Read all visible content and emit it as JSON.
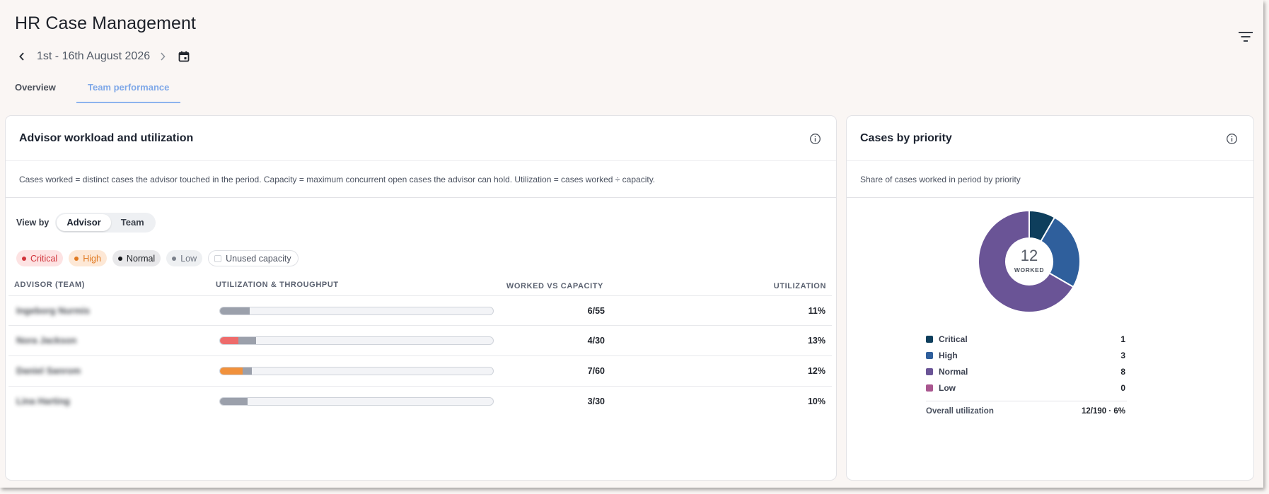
{
  "header": {
    "title": "HR Case Management",
    "date_range": "1st - 16th August 2026"
  },
  "tabs": [
    {
      "label": "Overview",
      "active": false
    },
    {
      "label": "Team performance",
      "active": true
    }
  ],
  "workload_card": {
    "title": "Advisor workload and utilization",
    "description": "Cases worked = distinct cases the advisor touched in the period. Capacity = maximum concurrent open cases the advisor can hold. Utilization = cases worked ÷ capacity.",
    "view_by": {
      "label": "View by",
      "options": [
        "Advisor",
        "Team"
      ],
      "selected": "Advisor"
    },
    "legend_chips": [
      "Critical",
      "High",
      "Normal",
      "Low",
      "Unused capacity"
    ],
    "columns": [
      "ADVISOR (TEAM)",
      "UTILIZATION & THROUGHPUT",
      "WORKED VS CAPACITY",
      "UTILIZATION"
    ],
    "rows": [
      {
        "advisor": "Ingeborg Nurmis",
        "worked": 6,
        "capacity": 55,
        "critical": 0,
        "high": 0,
        "normal": 6,
        "low": 0,
        "worked_vs_capacity": "6/55",
        "utilization": "11%"
      },
      {
        "advisor": "Nora Jackson",
        "worked": 4,
        "capacity": 30,
        "critical": 2,
        "high": 0,
        "normal": 2,
        "low": 0,
        "worked_vs_capacity": "4/30",
        "utilization": "13%"
      },
      {
        "advisor": "Daniel Sanrom",
        "worked": 7,
        "capacity": 60,
        "critical": 0,
        "high": 5,
        "normal": 2,
        "low": 0,
        "worked_vs_capacity": "7/60",
        "utilization": "12%"
      },
      {
        "advisor": "Lina Harting",
        "worked": 3,
        "capacity": 30,
        "critical": 0,
        "high": 0,
        "normal": 3,
        "low": 0,
        "worked_vs_capacity": "3/30",
        "utilization": "10%"
      }
    ]
  },
  "priority_card": {
    "title": "Cases by priority",
    "description": "Share of cases worked in period by priority",
    "center_value": "12",
    "center_label": "WORKED",
    "legend": [
      {
        "label": "Critical",
        "value": "1",
        "count": 1,
        "color": "#0e3e5c"
      },
      {
        "label": "High",
        "value": "3",
        "count": 3,
        "color": "#2f5f9c"
      },
      {
        "label": "Normal",
        "value": "8",
        "count": 8,
        "color": "#6a5496"
      },
      {
        "label": "Low",
        "value": "0",
        "count": 0,
        "color": "#a9568f"
      }
    ],
    "overall_label": "Overall utilization",
    "overall_value": "12/190 · 6%"
  },
  "colors": {
    "critical_bar": "#ee6b6b",
    "high_bar": "#f1913c",
    "normal_bar": "#9ba0ab",
    "low_bar": "#c4c8cf",
    "tab_active": "#7fa8e8"
  }
}
